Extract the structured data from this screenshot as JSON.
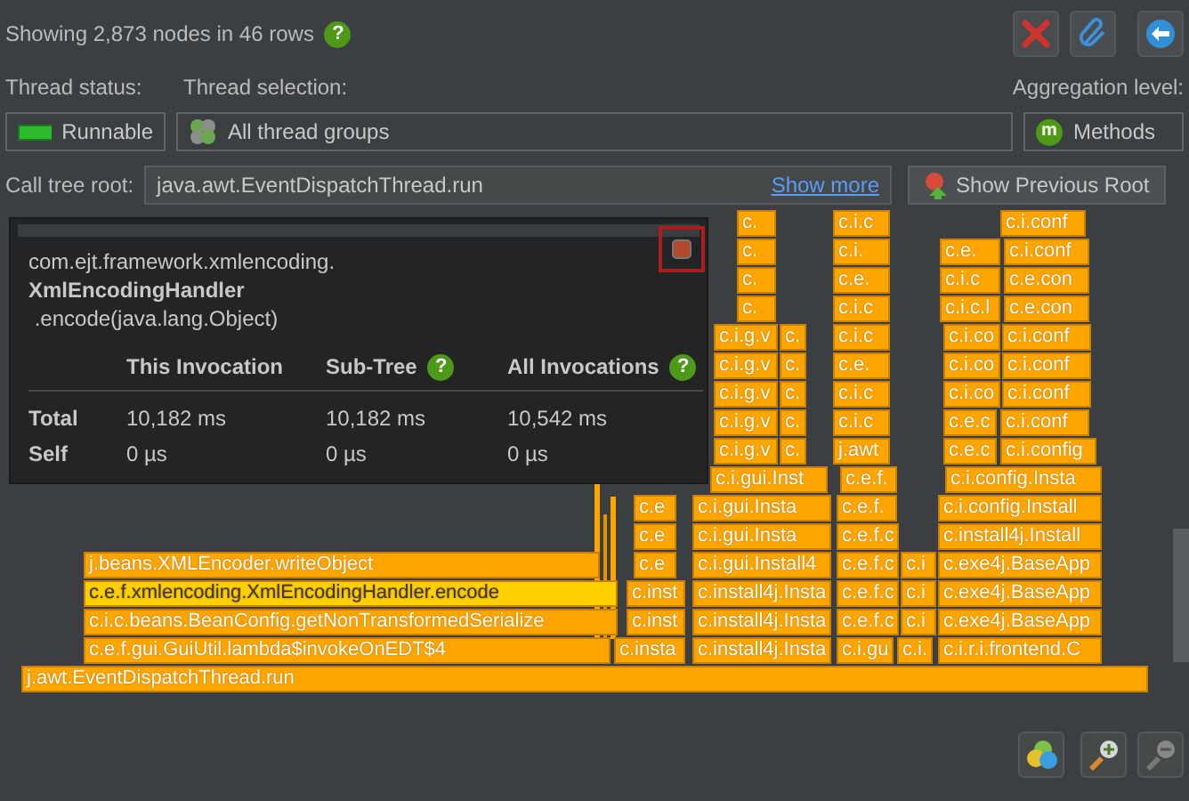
{
  "header": {
    "summary": "Showing 2,873 nodes in 46 rows",
    "help": "?"
  },
  "filters": {
    "thread_status": {
      "label": "Thread status:",
      "value": "Runnable"
    },
    "thread_selection": {
      "label": "Thread selection:",
      "value": "All thread groups"
    },
    "aggregation_level": {
      "label": "Aggregation level:",
      "value": "Methods",
      "badge": "m"
    }
  },
  "call_tree_root": {
    "label": "Call tree root:",
    "value": "java.awt.EventDispatchThread.run",
    "link": "Show more",
    "button": "Show Previous Root"
  },
  "tooltip": {
    "package": "com.ejt.framework.xmlencoding.",
    "class": "XmlEncodingHandler",
    "method": ".encode(java.lang.Object)",
    "columns": [
      {
        "label": "This Invocation"
      },
      {
        "label": "Sub-Tree",
        "help": "?"
      },
      {
        "label": "All Invocations",
        "help": "?"
      }
    ],
    "rows": [
      {
        "label": "Total",
        "values": [
          "10,182 ms",
          "10,182 ms",
          "10,542 ms"
        ]
      },
      {
        "label": "Self",
        "values": [
          "0 µs",
          "0 µs",
          "0 µs"
        ]
      }
    ]
  },
  "flame_graph": {
    "rows": [
      {
        "nodes": [
          {
            "label": "c.",
            "highlighted": false
          },
          {
            "label": "c.i.c",
            "highlighted": false
          },
          {
            "label": "c.i.conf",
            "highlighted": false
          }
        ]
      },
      {
        "nodes": [
          {
            "label": "c.",
            "highlighted": false
          },
          {
            "label": "c.i.",
            "highlighted": false
          },
          {
            "label": "c.e.",
            "highlighted": false
          },
          {
            "label": "c.i.conf",
            "highlighted": false
          }
        ]
      },
      {
        "nodes": [
          {
            "label": "c.",
            "highlighted": false
          },
          {
            "label": "c.e.",
            "highlighted": false
          },
          {
            "label": "c.i.c",
            "highlighted": false
          },
          {
            "label": "c.e.con",
            "highlighted": false
          }
        ]
      },
      {
        "nodes": [
          {
            "label": "c.",
            "highlighted": false
          },
          {
            "label": "c.i.c",
            "highlighted": false
          },
          {
            "label": "c.i.c.l",
            "highlighted": false
          },
          {
            "label": "c.e.con",
            "highlighted": false
          }
        ]
      },
      {
        "nodes": [
          {
            "label": "c.i.g.v",
            "highlighted": false
          },
          {
            "label": "c.",
            "highlighted": false
          },
          {
            "label": "c.i.c",
            "highlighted": false
          },
          {
            "label": "c.i.co",
            "highlighted": false
          },
          {
            "label": "c.i.conf",
            "highlighted": false
          }
        ]
      },
      {
        "nodes": [
          {
            "label": "c.i.g.v",
            "highlighted": false
          },
          {
            "label": "c.",
            "highlighted": false
          },
          {
            "label": "c.e.",
            "highlighted": false
          },
          {
            "label": "c.i.co",
            "highlighted": false
          },
          {
            "label": "c.i.conf",
            "highlighted": false
          }
        ]
      },
      {
        "nodes": [
          {
            "label": "c.i.g.v",
            "highlighted": false
          },
          {
            "label": "c.",
            "highlighted": false
          },
          {
            "label": "c.i.c",
            "highlighted": false
          },
          {
            "label": "c.i.co",
            "highlighted": false
          },
          {
            "label": "c.i.conf",
            "highlighted": false
          }
        ]
      },
      {
        "nodes": [
          {
            "label": "c.i.g.v",
            "highlighted": false
          },
          {
            "label": "c.",
            "highlighted": false
          },
          {
            "label": "c.i.c",
            "highlighted": false
          },
          {
            "label": "c.e.c",
            "highlighted": false
          },
          {
            "label": "c.i.conf",
            "highlighted": false
          }
        ]
      },
      {
        "nodes": [
          {
            "label": "c.i.g.v",
            "highlighted": false
          },
          {
            "label": "c.",
            "highlighted": false
          },
          {
            "label": "j.awt",
            "highlighted": false
          },
          {
            "label": "c.e.c",
            "highlighted": false
          },
          {
            "label": "c.i.config",
            "highlighted": false
          }
        ]
      },
      {
        "nodes": [
          {
            "label": "c.i.gui.Inst",
            "highlighted": false
          },
          {
            "label": "c.e.f.",
            "highlighted": false
          },
          {
            "label": "c.i.config.Insta",
            "highlighted": false
          }
        ]
      },
      {
        "nodes": [
          {
            "label": "c.e",
            "highlighted": false
          },
          {
            "label": "c.i.gui.Insta",
            "highlighted": false
          },
          {
            "label": "c.e.f.",
            "highlighted": false
          },
          {
            "label": "c.i.config.Install",
            "highlighted": false
          }
        ]
      },
      {
        "nodes": [
          {
            "label": "c.e",
            "highlighted": false
          },
          {
            "label": "c.i.gui.Insta",
            "highlighted": false
          },
          {
            "label": "c.e.f.c",
            "highlighted": false
          },
          {
            "label": "c.install4j.Install",
            "highlighted": false
          }
        ]
      },
      {
        "nodes": [
          {
            "label": "j.beans.XMLEncoder.writeObject",
            "highlighted": false
          },
          {
            "label": "c.e",
            "highlighted": false
          },
          {
            "label": "c.i.gui.Install4",
            "highlighted": false
          },
          {
            "label": "c.e.f.c",
            "highlighted": false
          },
          {
            "label": "c.i",
            "highlighted": false
          },
          {
            "label": "c.exe4j.BaseApp",
            "highlighted": false
          }
        ]
      },
      {
        "nodes": [
          {
            "label": "c.e.f.xmlencoding.XmlEncodingHandler.encode",
            "highlighted": true
          },
          {
            "label": "c.inst",
            "highlighted": false
          },
          {
            "label": "c.install4j.Insta",
            "highlighted": false
          },
          {
            "label": "c.e.f.c",
            "highlighted": false
          },
          {
            "label": "c.i",
            "highlighted": false
          },
          {
            "label": "c.exe4j.BaseApp",
            "highlighted": false
          }
        ]
      },
      {
        "nodes": [
          {
            "label": "c.i.c.beans.BeanConfig.getNonTransformedSerialize",
            "highlighted": false
          },
          {
            "label": "c.inst",
            "highlighted": false
          },
          {
            "label": "c.install4j.Insta",
            "highlighted": false
          },
          {
            "label": "c.e.f.c",
            "highlighted": false
          },
          {
            "label": "c.i",
            "highlighted": false
          },
          {
            "label": "c.exe4j.BaseApp",
            "highlighted": false
          }
        ]
      },
      {
        "nodes": [
          {
            "label": "c.e.f.gui.GuiUtil.lambda$invokeOnEDT$4",
            "highlighted": false
          },
          {
            "label": "c.insta",
            "highlighted": false
          },
          {
            "label": "c.install4j.Insta",
            "highlighted": false
          },
          {
            "label": "c.i.gu",
            "highlighted": false
          },
          {
            "label": "c.i.",
            "highlighted": false
          },
          {
            "label": "c.i.r.i.frontend.C",
            "highlighted": false
          }
        ]
      },
      {
        "nodes": [
          {
            "label": "j.awt.EventDispatchThread.run",
            "highlighted": false
          }
        ]
      }
    ]
  }
}
